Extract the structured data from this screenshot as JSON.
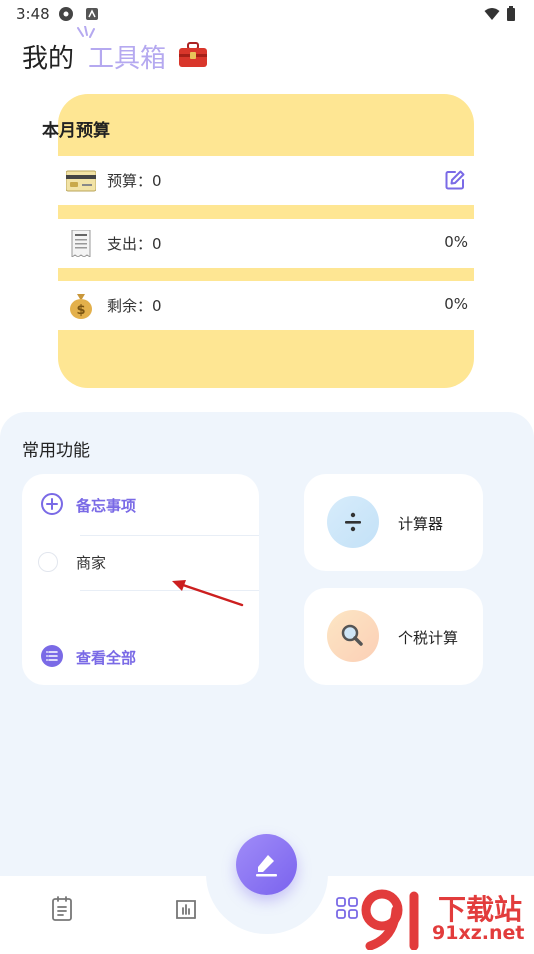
{
  "status_bar": {
    "time": "3:48"
  },
  "header": {
    "title_part1": "我的",
    "title_part2": "工具箱"
  },
  "budget": {
    "title": "本月预算",
    "rows": [
      {
        "label": "预算：0",
        "right": ""
      },
      {
        "label": "支出：0",
        "right": "0%"
      },
      {
        "label": "剩余：0",
        "right": "0%"
      }
    ]
  },
  "common": {
    "title": "常用功能",
    "memo": {
      "add_label": "备忘事项",
      "item": "商家",
      "view_all": "查看全部"
    },
    "tools": [
      {
        "label": "计算器"
      },
      {
        "label": "个税计算"
      }
    ]
  },
  "watermark": {
    "brand": "下载站",
    "domain": "91xz.net"
  },
  "colors": {
    "accent": "#7a6ae6",
    "budget_bg": "#fee693",
    "panel_bg": "#eff5fc"
  }
}
